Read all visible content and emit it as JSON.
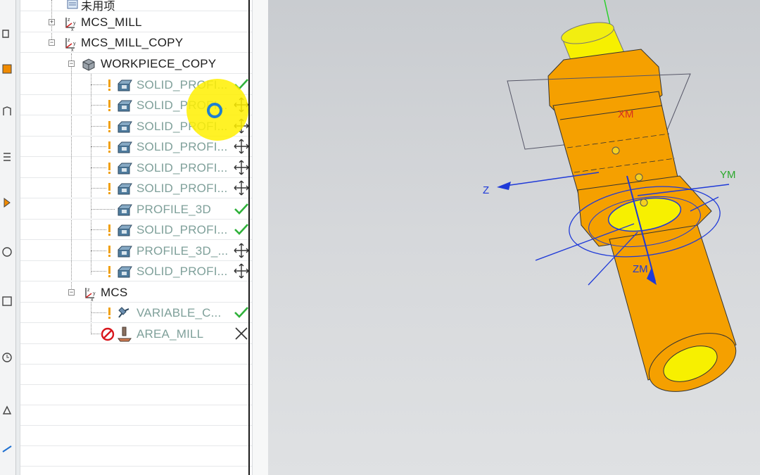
{
  "tree": {
    "partial_top_label": "未用项",
    "rows": [
      {
        "label": "MCS_MILL",
        "status": ""
      },
      {
        "label": "MCS_MILL_COPY",
        "status": ""
      },
      {
        "label": "WORKPIECE_COPY",
        "status": ""
      },
      {
        "label": "SOLID_PROFI...",
        "status": "check"
      },
      {
        "label": "SOLID_PROFI...",
        "status": "move"
      },
      {
        "label": "SOLID_PROFI...",
        "status": "move"
      },
      {
        "label": "SOLID_PROFI...",
        "status": "move"
      },
      {
        "label": "SOLID_PROFI...",
        "status": "move"
      },
      {
        "label": "SOLID_PROFI...",
        "status": "move"
      },
      {
        "label": "PROFILE_3D",
        "status": "check"
      },
      {
        "label": "SOLID_PROFI...",
        "status": "check"
      },
      {
        "label": "PROFILE_3D_...",
        "status": "move"
      },
      {
        "label": "SOLID_PROFI...",
        "status": "move"
      },
      {
        "label": "MCS",
        "status": ""
      },
      {
        "label": "VARIABLE_C...",
        "status": "check"
      },
      {
        "label": "AREA_MILL",
        "status": "cross"
      }
    ]
  },
  "viewport": {
    "axis_labels": {
      "xm": "XM",
      "ym": "YM",
      "zm": "ZM",
      "z": "Z"
    },
    "accent_colors": {
      "part": "#f5a000",
      "top": "#f7f000",
      "axis_green": "#2bd02b",
      "axis_blue": "#1f3ad8"
    }
  },
  "status_icons": {
    "check": "check-icon",
    "move": "move-icon",
    "cross": "cross-icon"
  }
}
